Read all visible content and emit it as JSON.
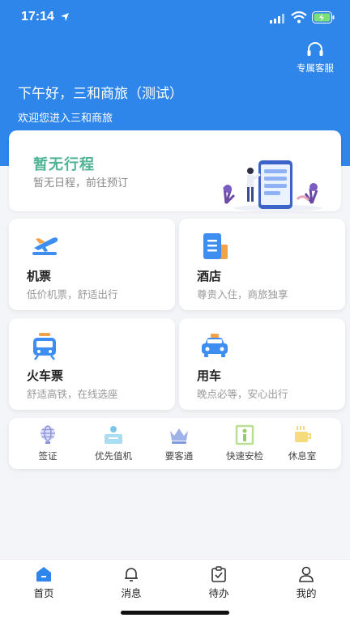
{
  "status_bar": {
    "time": "17:14"
  },
  "header": {
    "service_label": "专属客服",
    "greeting": "下午好，三和商旅（测试）",
    "welcome": "欢迎您进入三和商旅"
  },
  "trip": {
    "title": "暂无行程",
    "subtitle": "暂无日程，前往预订"
  },
  "services": [
    {
      "title": "机票",
      "subtitle": "低价机票，舒适出行",
      "icon": "airplane-icon"
    },
    {
      "title": "酒店",
      "subtitle": "尊贵入住，商旅独享",
      "icon": "hotel-icon"
    },
    {
      "title": "火车票",
      "subtitle": "舒适高铁，在线选座",
      "icon": "train-icon"
    },
    {
      "title": "用车",
      "subtitle": "晚点必等，安心出行",
      "icon": "car-icon"
    }
  ],
  "quick": [
    {
      "label": "签证",
      "icon": "globe-icon"
    },
    {
      "label": "优先值机",
      "icon": "checkin-icon"
    },
    {
      "label": "要客通",
      "icon": "crown-icon"
    },
    {
      "label": "快速安检",
      "icon": "security-gate-icon"
    },
    {
      "label": "休息室",
      "icon": "coffee-icon"
    }
  ],
  "tabs": [
    {
      "label": "首页",
      "icon": "home-icon",
      "active": true
    },
    {
      "label": "消息",
      "icon": "bell-icon"
    },
    {
      "label": "待办",
      "icon": "todo-icon"
    },
    {
      "label": "我的",
      "icon": "user-icon"
    }
  ],
  "colors": {
    "header_blue": "#2f86ea",
    "trip_green": "#4fb394",
    "icon_blue": "#3d8ef0"
  }
}
